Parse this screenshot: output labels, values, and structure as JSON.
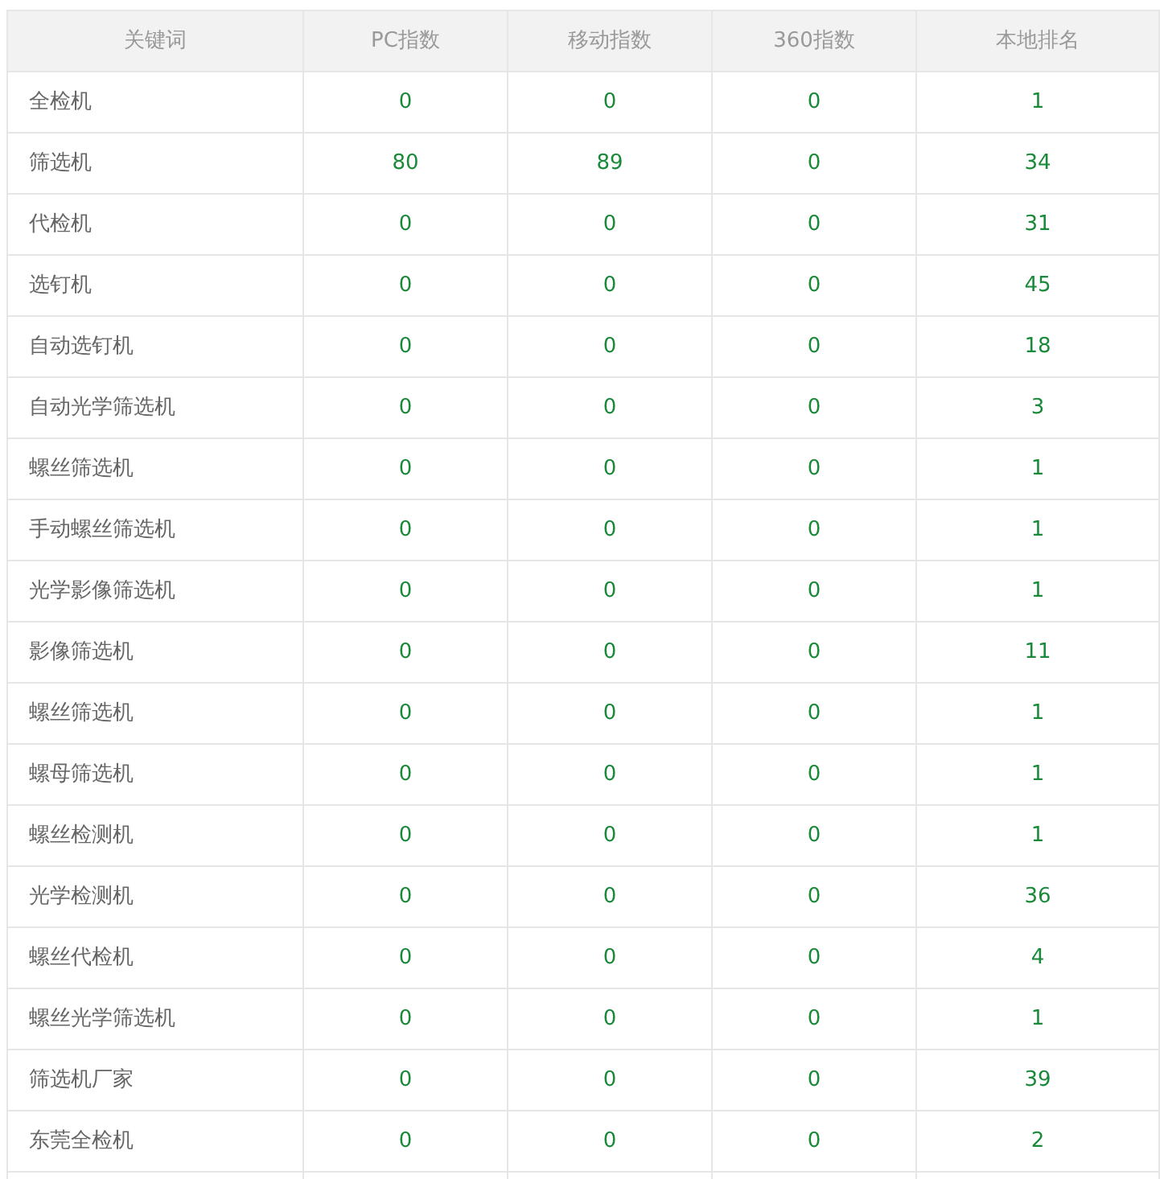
{
  "table": {
    "columns": [
      "关键词",
      "PC指数",
      "移动指数",
      "360指数",
      "本地排名"
    ],
    "rows": [
      [
        "全检机",
        "0",
        "0",
        "0",
        "1"
      ],
      [
        "筛选机",
        "80",
        "89",
        "0",
        "34"
      ],
      [
        "代检机",
        "0",
        "0",
        "0",
        "31"
      ],
      [
        "选钉机",
        "0",
        "0",
        "0",
        "45"
      ],
      [
        "自动选钉机",
        "0",
        "0",
        "0",
        "18"
      ],
      [
        "自动光学筛选机",
        "0",
        "0",
        "0",
        "3"
      ],
      [
        "螺丝筛选机",
        "0",
        "0",
        "0",
        "1"
      ],
      [
        "手动螺丝筛选机",
        "0",
        "0",
        "0",
        "1"
      ],
      [
        "光学影像筛选机",
        "0",
        "0",
        "0",
        "1"
      ],
      [
        "影像筛选机",
        "0",
        "0",
        "0",
        "11"
      ],
      [
        "螺丝筛选机",
        "0",
        "0",
        "0",
        "1"
      ],
      [
        "螺母筛选机",
        "0",
        "0",
        "0",
        "1"
      ],
      [
        "螺丝检测机",
        "0",
        "0",
        "0",
        "1"
      ],
      [
        "光学检测机",
        "0",
        "0",
        "0",
        "36"
      ],
      [
        "螺丝代检机",
        "0",
        "0",
        "0",
        "4"
      ],
      [
        "螺丝光学筛选机",
        "0",
        "0",
        "0",
        "1"
      ],
      [
        "筛选机厂家",
        "0",
        "0",
        "0",
        "39"
      ],
      [
        "东莞全检机",
        "0",
        "0",
        "0",
        "2"
      ]
    ]
  }
}
